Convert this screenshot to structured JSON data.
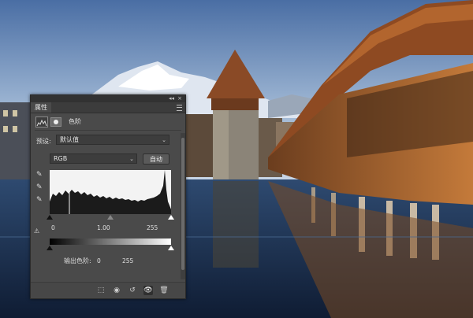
{
  "panel": {
    "tab_label": "属性",
    "adjustment_label": "色阶",
    "preset": {
      "label": "预设:",
      "value": "默认值"
    },
    "channel": {
      "value": "RGB"
    },
    "auto_button": "自动",
    "input_levels": {
      "black": "0",
      "gamma": "1.00",
      "white": "255"
    },
    "output_levels": {
      "label": "输出色阶:",
      "black": "0",
      "white": "255"
    },
    "icons": {
      "eyedroppers": [
        "eyedropper-black-icon",
        "eyedropper-gray-icon",
        "eyedropper-white-icon"
      ],
      "footer": [
        "clip-to-layer-icon",
        "view-previous-state-icon",
        "reset-icon",
        "visibility-eye-icon",
        "trash-icon"
      ]
    }
  }
}
